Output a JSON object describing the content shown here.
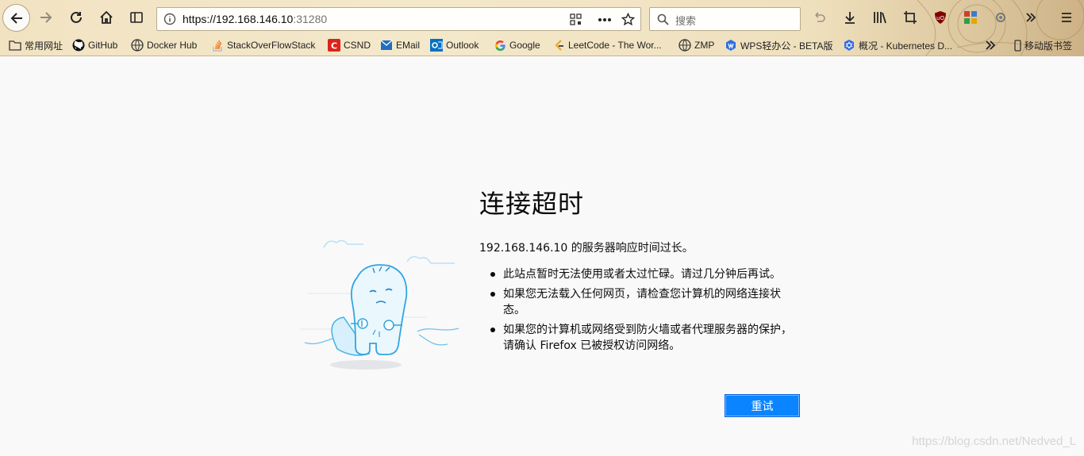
{
  "browser": {
    "url_main": "https://192.168.146.10",
    "url_port": ":31280",
    "search_placeholder": "搜索",
    "bookmarks": [
      {
        "label": "常用网址",
        "icon": "folder-icon"
      },
      {
        "label": "GitHub",
        "icon": "github-icon"
      },
      {
        "label": "Docker Hub",
        "icon": "globe-icon"
      },
      {
        "label": "StackOverFlowStack",
        "icon": "stackoverflow-icon"
      },
      {
        "label": "CSND",
        "icon": "csdn-icon"
      },
      {
        "label": "EMail",
        "icon": "mail-icon"
      },
      {
        "label": "Outlook",
        "icon": "outlook-icon"
      },
      {
        "label": "Google",
        "icon": "google-icon"
      },
      {
        "label": "LeetCode - The Wor...",
        "icon": "leetcode-icon"
      },
      {
        "label": "ZMP",
        "icon": "globe-icon"
      },
      {
        "label": "WPS轻办公 - BETA版",
        "icon": "wps-icon"
      },
      {
        "label": "概况 - Kubernetes D...",
        "icon": "kubernetes-icon"
      }
    ],
    "mobile_bookmarks": "移动版书签"
  },
  "error": {
    "title": "连接超时",
    "lead": "192.168.146.10 的服务器响应时间过长。",
    "bullets": [
      "此站点暂时无法使用或者太过忙碌。请过几分钟后再试。",
      "如果您无法载入任何网页，请检查您计算机的网络连接状态。",
      "如果您的计算机或网络受到防火墙或者代理服务器的保护，请确认 Firefox 已被授权访问网络。"
    ],
    "retry_label": "重试"
  },
  "watermark": "https://blog.csdn.net/Nedved_L"
}
